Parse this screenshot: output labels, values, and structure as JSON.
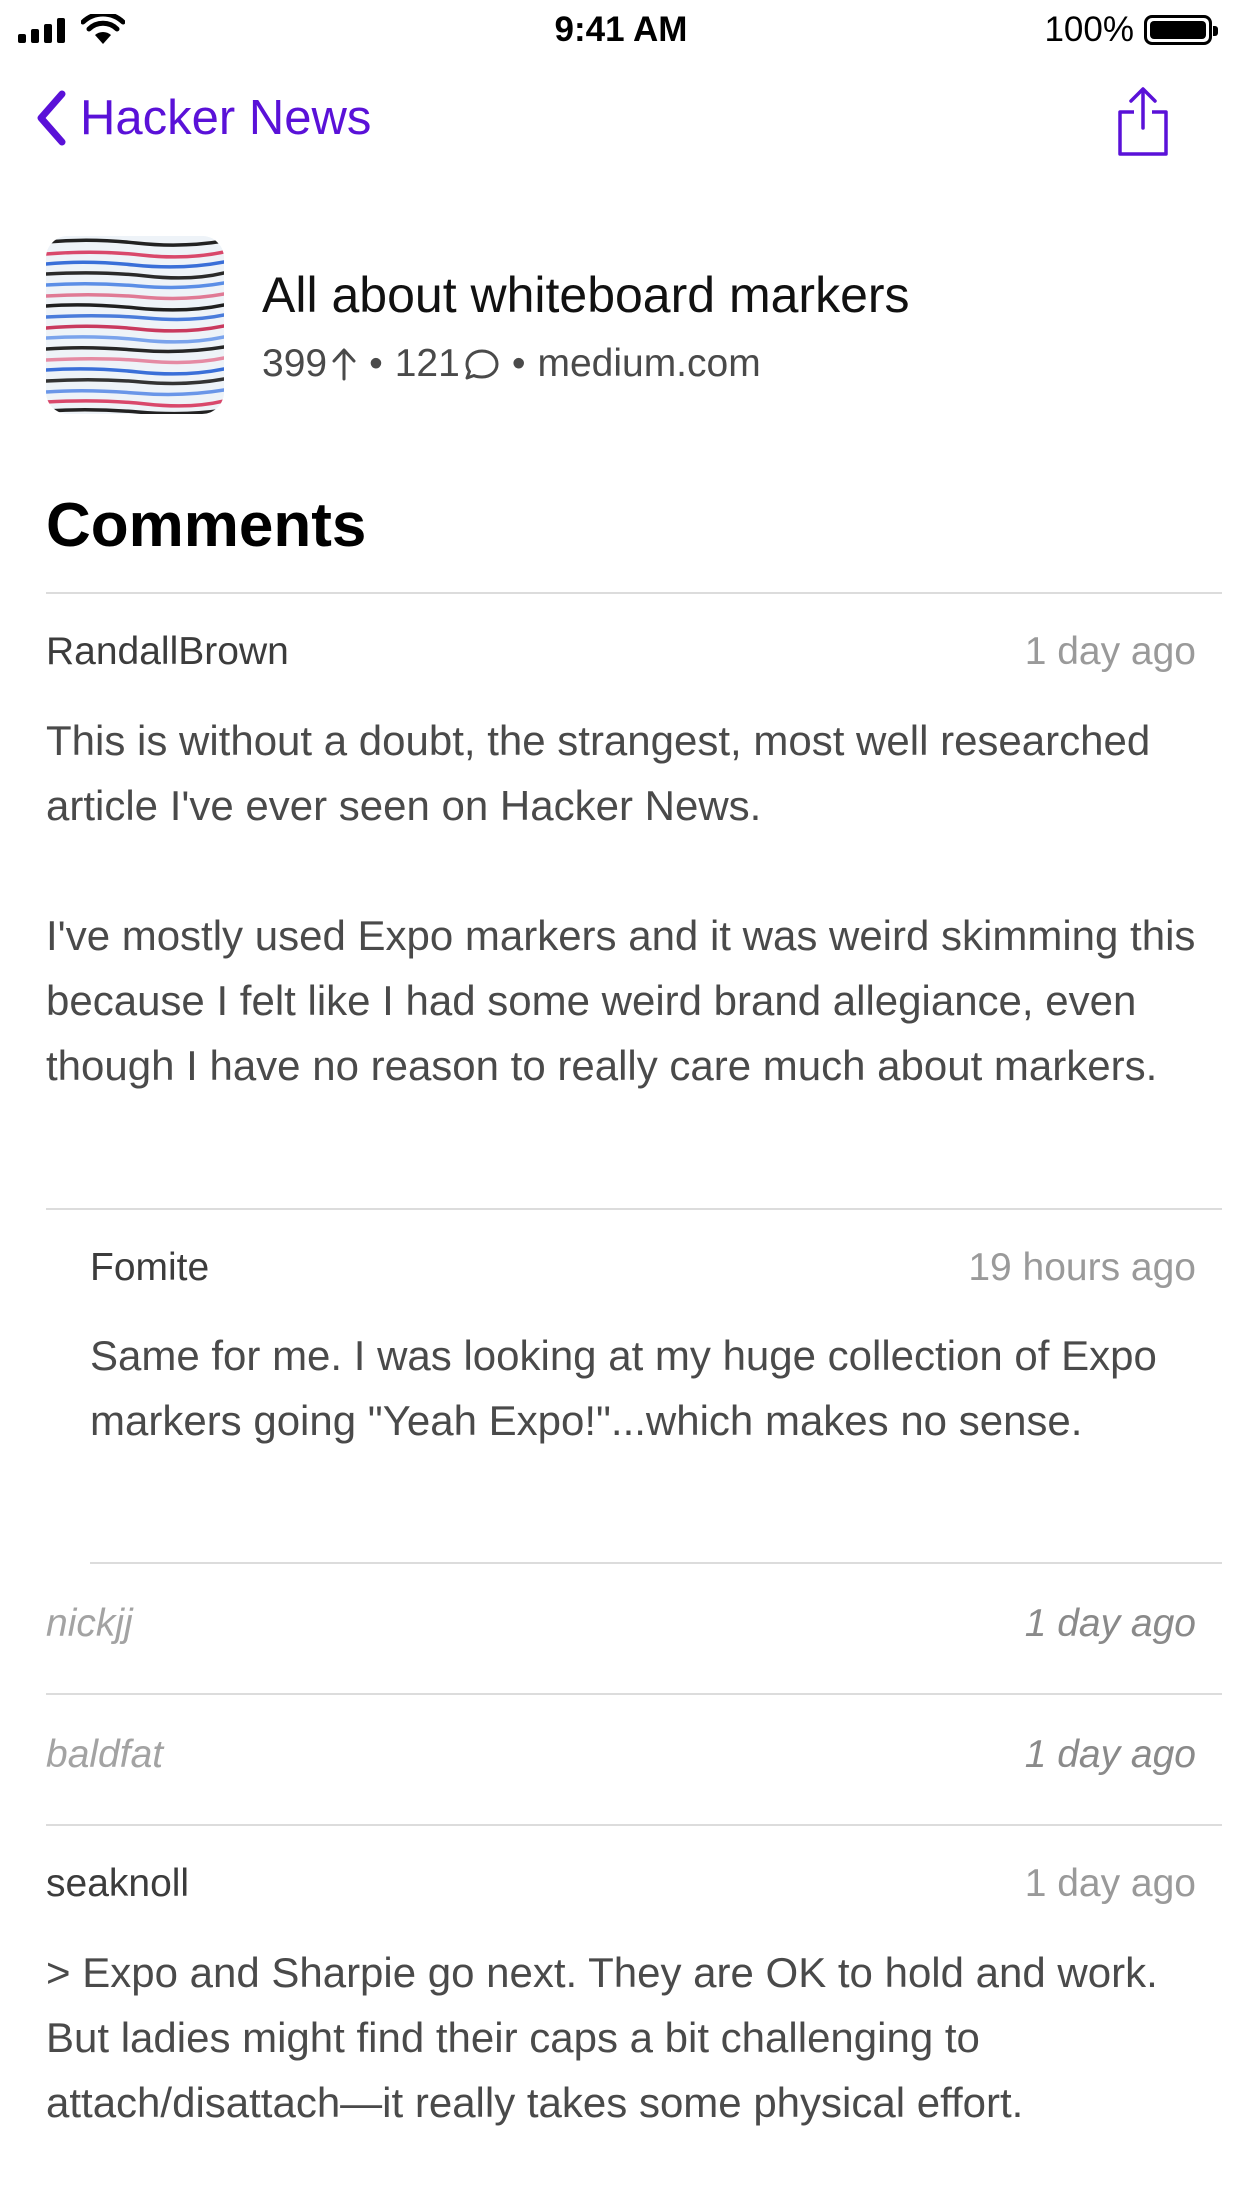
{
  "status_bar": {
    "time": "9:41 AM",
    "battery_percent": "100%"
  },
  "nav": {
    "back_label": "Hacker News",
    "accent_color": "#5a11d8"
  },
  "story": {
    "title": "All about whiteboard markers",
    "points": "399",
    "comments_count": "121",
    "domain": "medium.com"
  },
  "comments_heading": "Comments",
  "comments": [
    {
      "author": "RandallBrown",
      "time": "1 day ago",
      "body": "This is without a doubt, the strangest, most well researched article I've ever seen on Hacker News.\n\nI've mostly used Expo markers and it was weird skimming this because I felt like I had some weird brand allegiance, even though I have no reason to really care much about markers."
    },
    {
      "author": "Fomite",
      "time": "19 hours ago",
      "body": "Same for me. I was looking at my huge collection of Expo markers going \"Yeah Expo!\"...which makes no sense."
    },
    {
      "author": "nickjj",
      "time": "1 day ago"
    },
    {
      "author": "baldfat",
      "time": "1 day ago"
    },
    {
      "author": "seaknoll",
      "time": "1 day ago",
      "body": "> Expo and Sharpie go next. They are OK to hold and work. But ladies might find their caps a bit challenging to attach/disattach—it really takes some physical effort."
    }
  ]
}
